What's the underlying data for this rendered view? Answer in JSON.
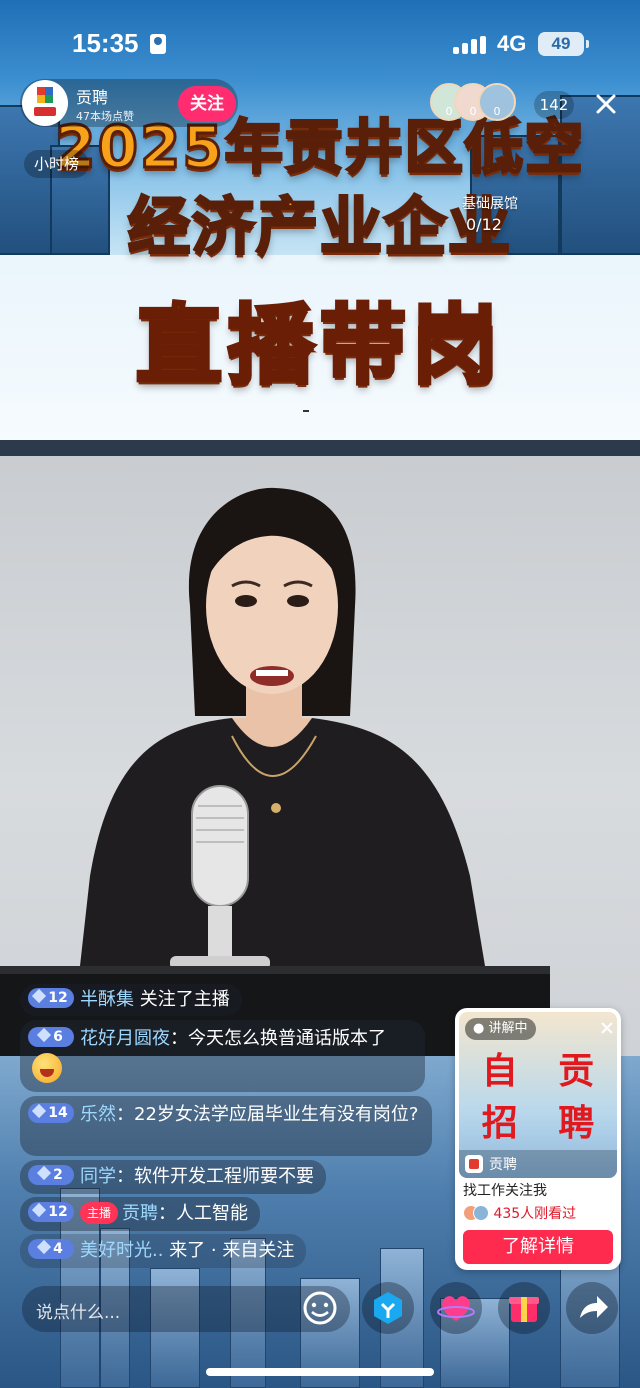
{
  "status_bar": {
    "time": "15:35",
    "network": "4G",
    "battery": "49"
  },
  "header": {
    "host_name": "贡聘",
    "likes_text": "47本场点赞",
    "follow_label": "关注",
    "viewer_counts": [
      "0",
      "0",
      "0"
    ],
    "viewer_total": "142",
    "hourly_rank_label": "小时榜",
    "hall_label": "基础展馆",
    "hall_count": "0/12"
  },
  "banner": {
    "title_line_1": "2025年贡井区低空",
    "title_line_2": "经济产业企业",
    "title_line_3": "直播带岗"
  },
  "chat": [
    {
      "level": "12",
      "user": "半酥集",
      "message": "关注了主播",
      "separator": " "
    },
    {
      "level": "6",
      "user": "花好月圆夜",
      "message": "今天怎么换普通话版本了",
      "separator": "："
    },
    {
      "level": "14",
      "user": "乐然",
      "message": "22岁女法学应届毕业生有没有岗位?",
      "separator": "："
    },
    {
      "level": "2",
      "user": "同学",
      "message": "软件开发工程师要不要",
      "separator": "："
    },
    {
      "level": "12",
      "host_tag": "主播",
      "user": "贡聘",
      "message": "人工智能",
      "separator": "："
    },
    {
      "level": "4",
      "user": "美好时光..",
      "message": "来了 · 来自关注",
      "separator": " "
    }
  ],
  "promo_card": {
    "live_label": "讲解中",
    "title": "自 贡\n招 聘",
    "brand_name": "贡聘",
    "subtitle": "找工作关注我",
    "viewers_text": "435人刚看过",
    "cta_label": "了解详情"
  },
  "bottom_bar": {
    "comment_placeholder": "说点什么..."
  },
  "colors": {
    "follow": "#ff2d6f",
    "cta": "#ff2b4e",
    "promo_title": "#e0191f",
    "chat_user": "#9fd8ff",
    "level_badge": "#5b7fe0"
  },
  "icons": [
    "person-icon",
    "signal-icon",
    "battery-icon",
    "close-icon",
    "emoji-icon",
    "fan-icon",
    "heart-icon",
    "gift-icon",
    "share-icon"
  ]
}
